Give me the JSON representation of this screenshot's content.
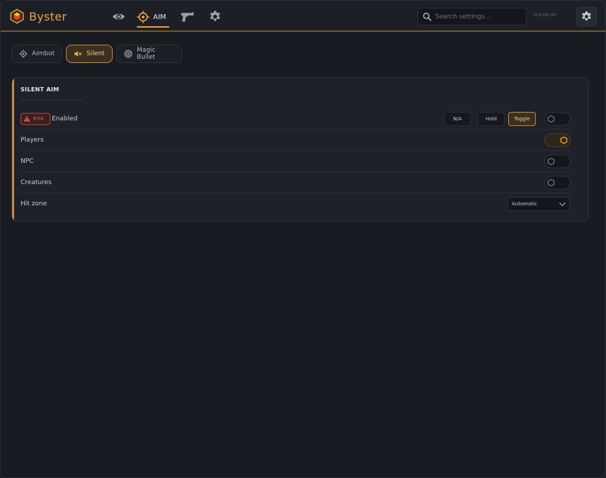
{
  "app": {
    "name": "Byster",
    "accent_color": "#f0a23c",
    "build_id": "20A38C8F"
  },
  "header": {
    "nav": [
      {
        "id": "visuals",
        "icon": "eye-icon",
        "label": ""
      },
      {
        "id": "aim",
        "icon": "crosshair-icon",
        "label": "AIM",
        "active": true
      },
      {
        "id": "weapons",
        "icon": "gun-icon",
        "label": ""
      },
      {
        "id": "misc",
        "icon": "gear-icon",
        "label": ""
      }
    ],
    "search": {
      "placeholder": "Search settings...",
      "value": ""
    },
    "settings_icon": "gear-icon"
  },
  "subtabs": [
    {
      "label": "Aimbot",
      "icon": "crosshair-icon",
      "active": false
    },
    {
      "label": "Silent",
      "icon": "muted-speaker-icon",
      "active": true
    },
    {
      "label": "Magic Bullet",
      "icon": "target-icon",
      "active": false
    }
  ],
  "panel": {
    "title": "SILENT AIM",
    "rows": [
      {
        "label": "Enabled",
        "badge": "RISK",
        "modes": [
          "N/A",
          "Hold",
          "Toggle"
        ],
        "active_mode": "Toggle",
        "toggle_on": false
      },
      {
        "label": "Players",
        "toggle_on": true
      },
      {
        "label": "NPC",
        "toggle_on": false
      },
      {
        "label": "Creatures",
        "toggle_on": false
      },
      {
        "label": "Hit zone",
        "select_value": "Automatic"
      }
    ]
  }
}
